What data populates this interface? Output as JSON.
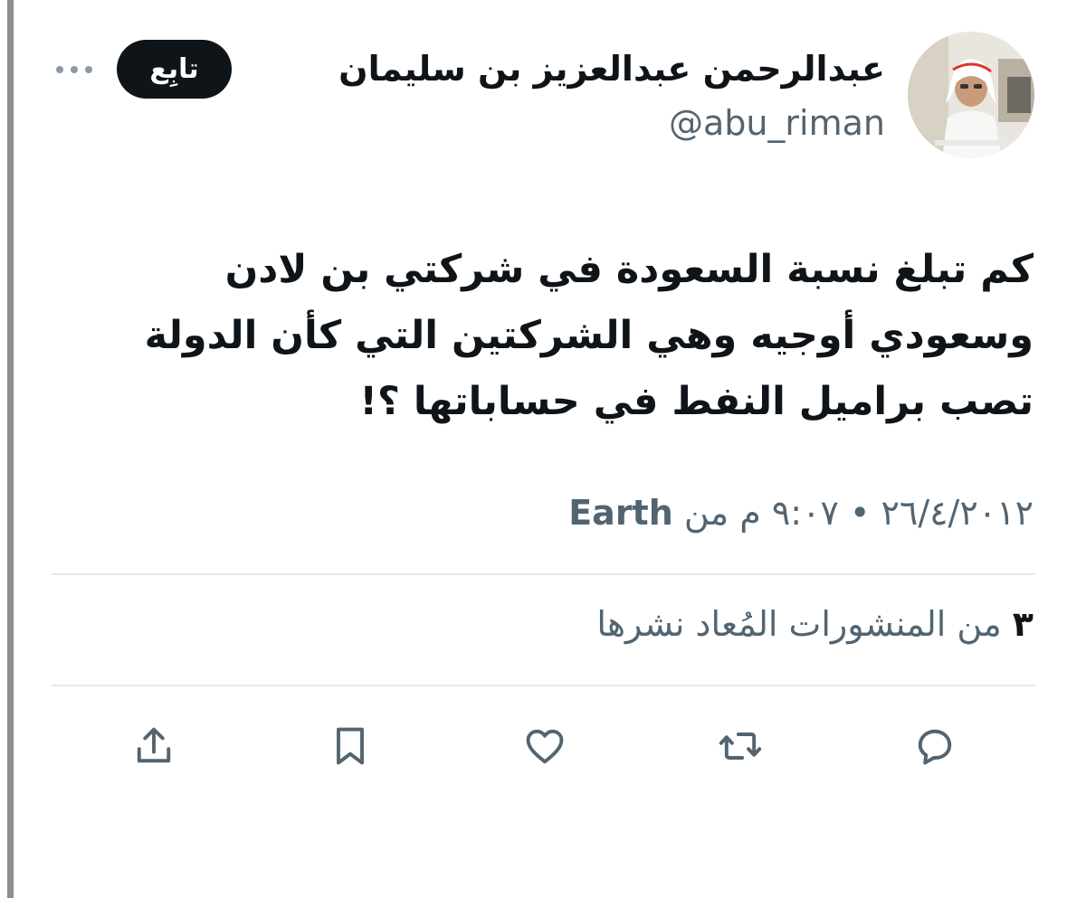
{
  "author": {
    "display_name": "عبدالرحمن عبدالعزيز بن سليمان",
    "handle": "@abu_riman",
    "avatar_icon": "profile-photo"
  },
  "follow_button": {
    "label": "تابِع"
  },
  "more_menu": {
    "icon": "more-dots-icon"
  },
  "tweet": {
    "lines": [
      "كم تبلغ نسبة السعودة في شركتي بن لادن",
      "وسعودي أوجيه وهي الشركتين التي كأن الدولة",
      "تصب براميل النفط في حساباتها ؟!"
    ]
  },
  "meta": {
    "date": "٢٦/٤/٢٠١٢",
    "separator": "•",
    "time": "٩:٠٧ م",
    "from_label": "من",
    "source": "Earth"
  },
  "reposts": {
    "count": "٣",
    "label": "من المنشورات المُعاد نشرها"
  },
  "actions": [
    {
      "name": "reply",
      "icon": "reply-icon"
    },
    {
      "name": "repost",
      "icon": "repost-icon"
    },
    {
      "name": "like",
      "icon": "heart-icon"
    },
    {
      "name": "bookmark",
      "icon": "bookmark-icon"
    },
    {
      "name": "share",
      "icon": "share-icon"
    }
  ],
  "colors": {
    "text": "#0f1419",
    "secondary": "#536471",
    "divider": "#e6e9ec",
    "button_bg": "#0f1419"
  }
}
